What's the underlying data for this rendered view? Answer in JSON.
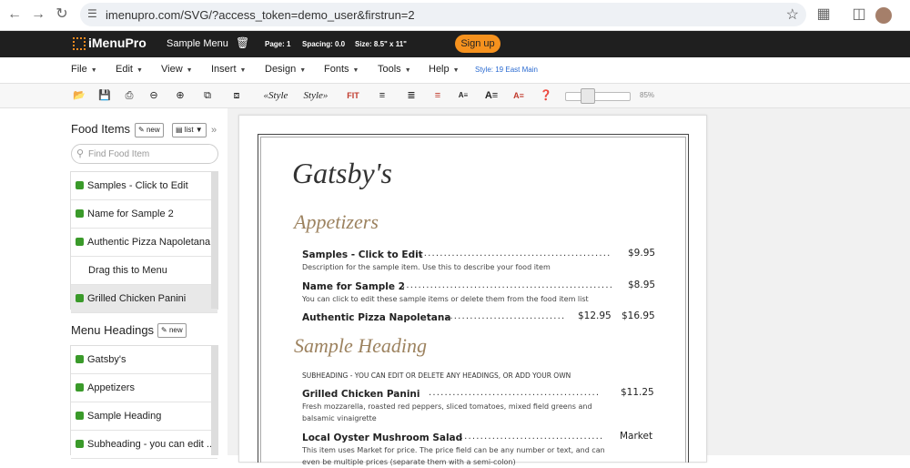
{
  "browser": {
    "url": "imenupro.com/SVG/?access_token=demo_user&firstrun=2"
  },
  "app": {
    "logo": "iMenuPro",
    "menu_name": "Sample Menu",
    "page": "Page: 1",
    "spacing": "Spacing: 0.0",
    "size": "Size: 8.5\" x 11\"",
    "signup": "Sign up"
  },
  "menubar": {
    "items": [
      "File",
      "Edit",
      "View",
      "Insert",
      "Design",
      "Fonts",
      "Tools",
      "Help"
    ],
    "style_link": "Style: 19 East Main"
  },
  "toolbar": {
    "style_prev": "«Style",
    "style_next": "Style»",
    "fit": "FIT",
    "zoom": "85%"
  },
  "sidebar": {
    "food_title": "Food Items",
    "new_label": "new",
    "list_label": "list",
    "search_placeholder": "Find Food Item",
    "food_items": [
      "Samples - Click to Edit",
      "Name for Sample 2",
      "Authentic Pizza Napoletana",
      "Drag this to Menu",
      "Grilled Chicken Panini"
    ],
    "headings_title": "Menu Headings",
    "headings": [
      "Gatsby's",
      "Appetizers",
      "Sample Heading",
      "Subheading - you can edit ..."
    ]
  },
  "menu": {
    "title": "Gatsby's",
    "section1": "Appetizers",
    "items1": [
      {
        "name": "Samples - Click to Edit",
        "price": "$9.95",
        "desc": "Description for the sample item. Use this to describe your food item"
      },
      {
        "name": "Name for Sample 2",
        "price": "$8.95",
        "desc": "You can click to edit these sample items or delete them from the food item list"
      },
      {
        "name": "Authentic Pizza Napoletana",
        "price": "$12.95",
        "price2": "$16.95"
      }
    ],
    "section2": "Sample Heading",
    "subheading": "SUBHEADING - YOU CAN EDIT OR DELETE ANY HEADINGS, OR ADD YOUR OWN",
    "items2": [
      {
        "name": "Grilled Chicken Panini",
        "price": "$11.25",
        "desc1": "Fresh mozzarella, roasted red peppers, sliced tomatoes, mixed field greens and",
        "desc2": "balsamic vinaigrette"
      },
      {
        "name": "Local Oyster Mushroom Salad",
        "price": "Market",
        "desc1": "This item uses Market for price. The price field can be any number or text, and can",
        "desc2": "even be multiple prices (separate them with a semi-colon)"
      }
    ]
  }
}
